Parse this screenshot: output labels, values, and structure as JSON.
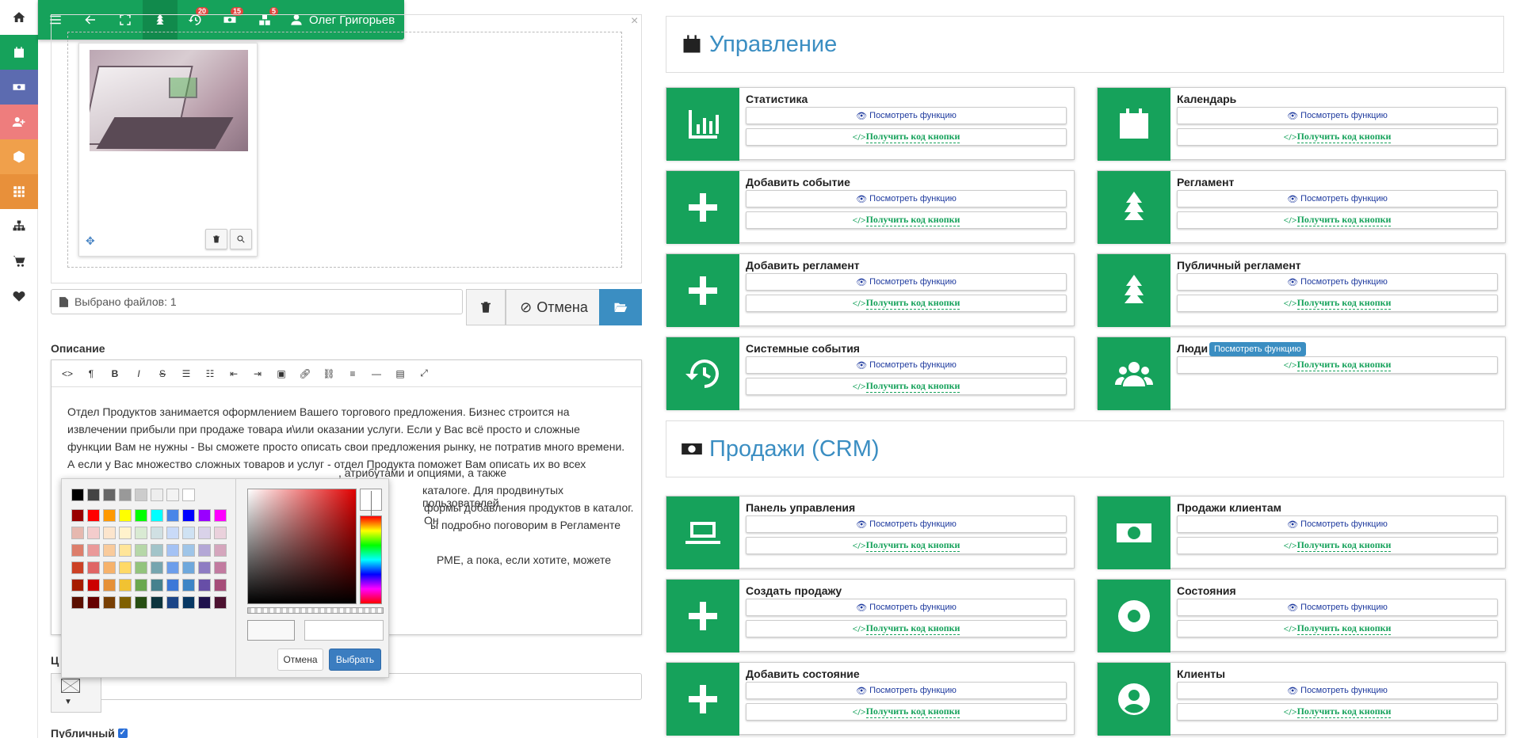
{
  "topbar": {
    "user_name": "Олег Григорьев",
    "badges": {
      "history": "20",
      "sales": "15",
      "modules": "5"
    }
  },
  "upload": {
    "files_selected": "Выбрано файлов: 1",
    "cancel_label": "Отмена"
  },
  "description": {
    "label": "Описание",
    "paragraph1": "Отдел Продуктов занимается оформлением Вашего торгового предложения. Бизнес строится на извлечении прибыли при продаже товара и\\или оказании услуги. Если у Вас всё просто и сложные функции Вам не нужны - Вы сможете просто описать свои предложения рынку, не потратив много времени. А если у Вас множество сложных товаров и услуг - отдел Продукта поможет Вам описать их во всех",
    "frag1": ", атрибутами и опциями, а также",
    "frag2": "каталоге. Для продвинутых пользователей",
    "frag3": "формы добавления продуктов в каталог. Он",
    "frag4": "ы подробно поговорим в Регламенте",
    "frag5": "РМЕ, а пока, если хотите, можете"
  },
  "colorpicker": {
    "cancel_label": "Отмена",
    "ok_label": "Выбрать"
  },
  "color_label": "Ц",
  "public_label": "Публичный",
  "sections": {
    "management": "Управление",
    "sales": "Продажи (CRM)"
  },
  "buttons": {
    "view": "Посмотреть функцию",
    "code": "Получить код кнопки"
  },
  "tooltip": "Посмотреть функцию",
  "cards": [
    {
      "title": "Статистика"
    },
    {
      "title": "Календарь"
    },
    {
      "title": "Добавить событие"
    },
    {
      "title": "Регламент"
    },
    {
      "title": "Добавить регламент"
    },
    {
      "title": "Публичный регламент"
    },
    {
      "title": "Системные события"
    },
    {
      "title": "Люди"
    },
    {
      "title": "Панель управления"
    },
    {
      "title": "Продажи клиентам"
    },
    {
      "title": "Создать продажу"
    },
    {
      "title": "Состояния"
    },
    {
      "title": "Добавить состояние"
    },
    {
      "title": "Клиенты"
    }
  ],
  "colors": {
    "accent": "#16a25b",
    "link": "#3b8ec2",
    "badge": "#e0453d",
    "sidebar_pink": "#ee7d7d",
    "sidebar_orange": "#f0a04b",
    "sidebar_slate": "#5c6bb0"
  }
}
